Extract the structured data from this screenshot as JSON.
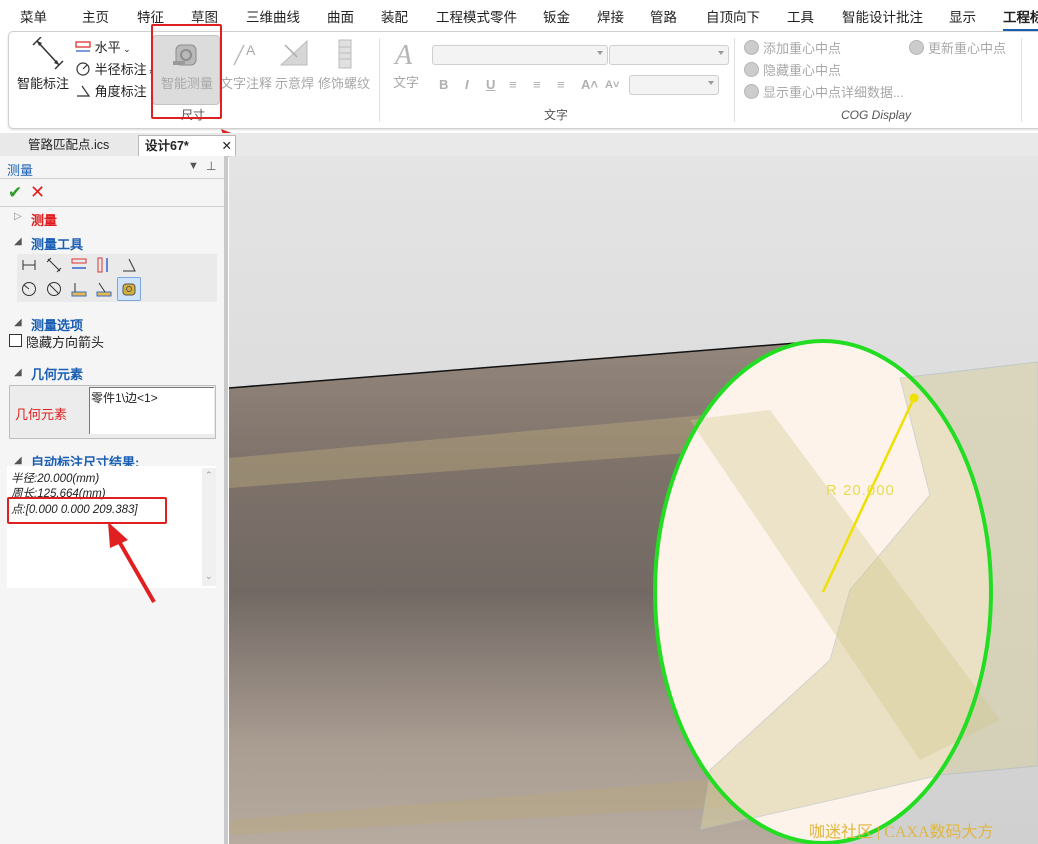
{
  "menubar": {
    "items": [
      "菜单",
      "主页",
      "特征",
      "草图",
      "三维曲线",
      "曲面",
      "装配",
      "工程模式零件",
      "钣金",
      "焊接",
      "管路",
      "自顶向下",
      "工具",
      "智能设计批注",
      "显示",
      "工程标"
    ],
    "active": "工程标"
  },
  "ribbon": {
    "smart_dim_label": "智能标注",
    "horizontal_label": "水平",
    "radius_label": "半径标注",
    "angle_label": "角度标注",
    "smart_measure_label": "智能测量",
    "text_note_label": "文字注释",
    "weld_label": "示意焊",
    "thread_label": "修饰螺纹",
    "group_dimension": "尺寸",
    "text_big_label": "文字",
    "group_text": "文字",
    "format_buttons": [
      "B",
      "I",
      "U",
      "≡",
      "≡",
      "≡",
      "A˄",
      "A˅"
    ],
    "cog_add": "添加重心中点",
    "cog_hide": "隐藏重心中点",
    "cog_show_detail": "显示重心中点详细数据...",
    "cog_update": "更新重心中点",
    "group_cog": "COG Display"
  },
  "tabs": [
    {
      "label": "管路匹配点.ics",
      "active": false
    },
    {
      "label": "设计67*",
      "active": true
    }
  ],
  "panel": {
    "title": "测量",
    "measure_section": "测量",
    "tools_section": "测量工具",
    "options_section": "测量选项",
    "hide_arrow_label": "隐藏方向箭头",
    "hide_arrow_checked": false,
    "geometry_section": "几何元素",
    "geometry_label": "几何元素",
    "geometry_value": "零件1\\边<1>",
    "results_section": "自动标注尺寸结果:",
    "results": [
      "半径:20.000(mm)",
      "周长:125.664(mm)",
      "点:[0.000  0.000  209.383]"
    ]
  },
  "viewport": {
    "dimension_label": "R  20.000",
    "watermark": "咖迷社区 | CAXA数码大方"
  },
  "colors": {
    "accent": "#1a5fb4",
    "highlight": "#e02020",
    "circle": "#22dd22",
    "dimension": "#f0e000"
  }
}
